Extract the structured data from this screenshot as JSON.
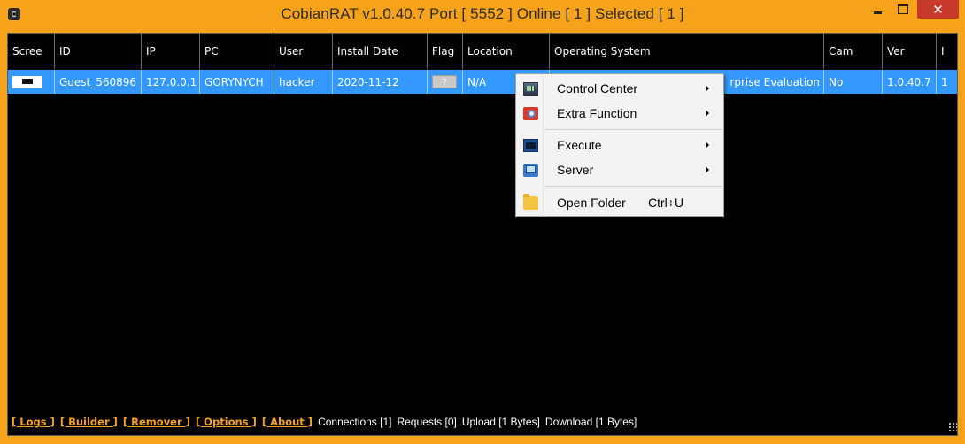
{
  "window": {
    "title": "CobianRAT v1.0.40.7   Port [ 5552 ]   Online [ 1 ]   Selected [ 1 ]",
    "close_glyph": "✕",
    "accent_color": "#f6a21a",
    "selection_color": "#3399ff"
  },
  "grid": {
    "columns": [
      {
        "key": "screen",
        "label": "Scree"
      },
      {
        "key": "id",
        "label": "ID"
      },
      {
        "key": "ip",
        "label": "IP"
      },
      {
        "key": "pc",
        "label": "PC"
      },
      {
        "key": "user",
        "label": "User"
      },
      {
        "key": "install_date",
        "label": "Install Date"
      },
      {
        "key": "flag",
        "label": "Flag"
      },
      {
        "key": "location",
        "label": "Location"
      },
      {
        "key": "os",
        "label": "Operating System"
      },
      {
        "key": "cam",
        "label": "Cam"
      },
      {
        "key": "ver",
        "label": "Ver"
      },
      {
        "key": "extra",
        "label": "I"
      }
    ],
    "rows": [
      {
        "screen": "",
        "id": "Guest_560896",
        "ip": "127.0.0.1",
        "pc": "GORYNYCH",
        "user": "hacker",
        "install_date": "2020-11-12",
        "flag": "?",
        "location": "N/A",
        "os": "rprise Evaluation",
        "cam": "No",
        "ver": "1.0.40.7",
        "extra": "1"
      }
    ]
  },
  "context_menu": {
    "items": [
      {
        "label": "Control Center",
        "icon": "control-center-icon",
        "submenu": true
      },
      {
        "label": "Extra Function",
        "icon": "extra-function-icon",
        "submenu": true
      },
      {
        "label": "Execute",
        "icon": "execute-icon",
        "submenu": true
      },
      {
        "label": "Server",
        "icon": "server-icon",
        "submenu": true
      },
      {
        "label": "Open Folder",
        "shortcut": "Ctrl+U",
        "icon": "folder-icon",
        "submenu": false
      }
    ]
  },
  "statusbar": {
    "links": [
      "[ Logs ]",
      "[ Builder ]",
      "[ Remover ]",
      "[ Options ]",
      "[ About ]"
    ],
    "stats": [
      "Connections [1]",
      "Requests [0]",
      "Upload [1 Bytes]",
      "Download [1 Bytes]"
    ]
  }
}
